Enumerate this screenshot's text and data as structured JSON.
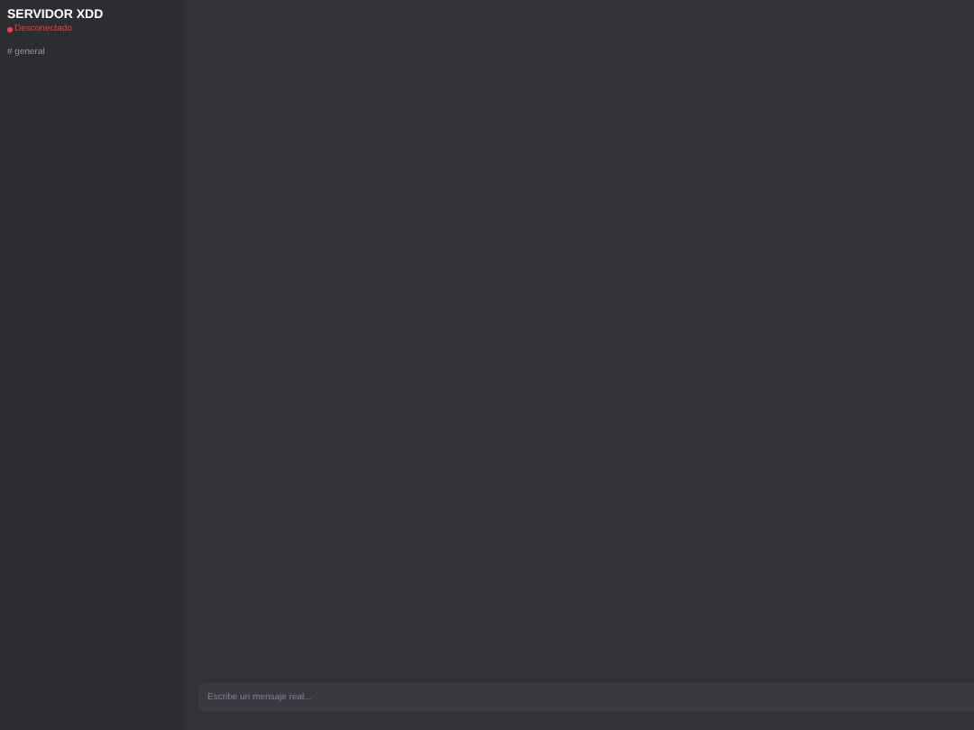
{
  "server": {
    "name": "SERVIDOR XDD",
    "status": {
      "label": "Desconectado",
      "connected": false
    }
  },
  "channels": [
    {
      "label": "# general"
    }
  ],
  "composer": {
    "placeholder": "Escribe un mensaje real..."
  }
}
